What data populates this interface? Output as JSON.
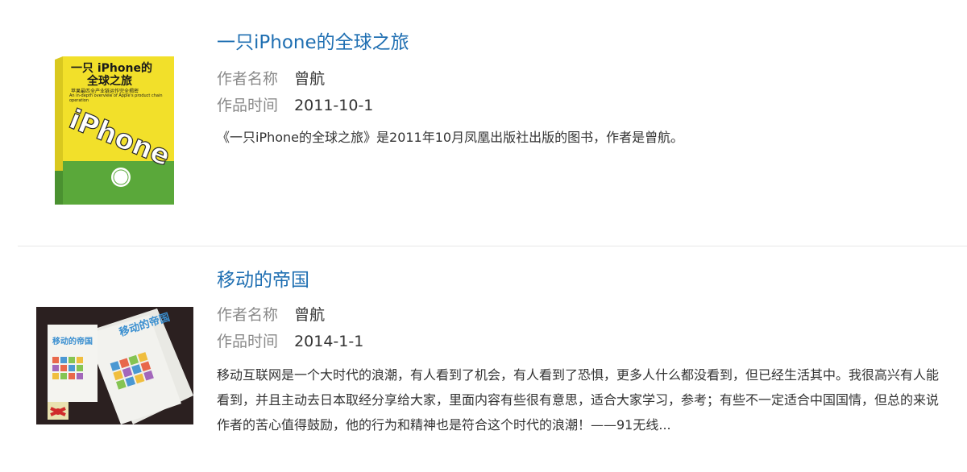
{
  "labels": {
    "author": "作者名称",
    "time": "作品时间"
  },
  "items": [
    {
      "title": "一只iPhone的全球之旅",
      "author": "曾航",
      "time": "2011-10-1",
      "description": "《一只iPhone的全球之旅》是2011年10月凤凰出版社出版的图书，作者是曾航。",
      "cover": {
        "title_line1": "一只 iPhone的",
        "title_line2": "全球之旅",
        "subtitle": "苹果最匹全产业链运作完全揭密",
        "english": "An in-depth overview of Apple's product chain operation",
        "big_word": "iPhone",
        "colors": {
          "yellow": "#f2e02a",
          "green": "#5aa83a"
        }
      }
    },
    {
      "title": "移动的帝国",
      "author": "曾航",
      "time": "2014-1-1",
      "description": "移动互联网是一个大时代的浪潮，有人看到了机会，有人看到了恐惧，更多人什么都没看到，但已经生活其中。我很高兴有人能看到，并且主动去日本取经分享给大家，里面内容有些很有意思，适合大家学习，参考；有些不一定适合中国国情，但总的来说作者的苦心值得鼓励，他的行为和精神也是符合这个时代的浪潮！——91无线...",
      "cover": {
        "title": "移动的帝国",
        "colors": {
          "background": "#2b2020",
          "book": "#f2f2ee",
          "title": "#3a8fd0"
        }
      }
    }
  ]
}
